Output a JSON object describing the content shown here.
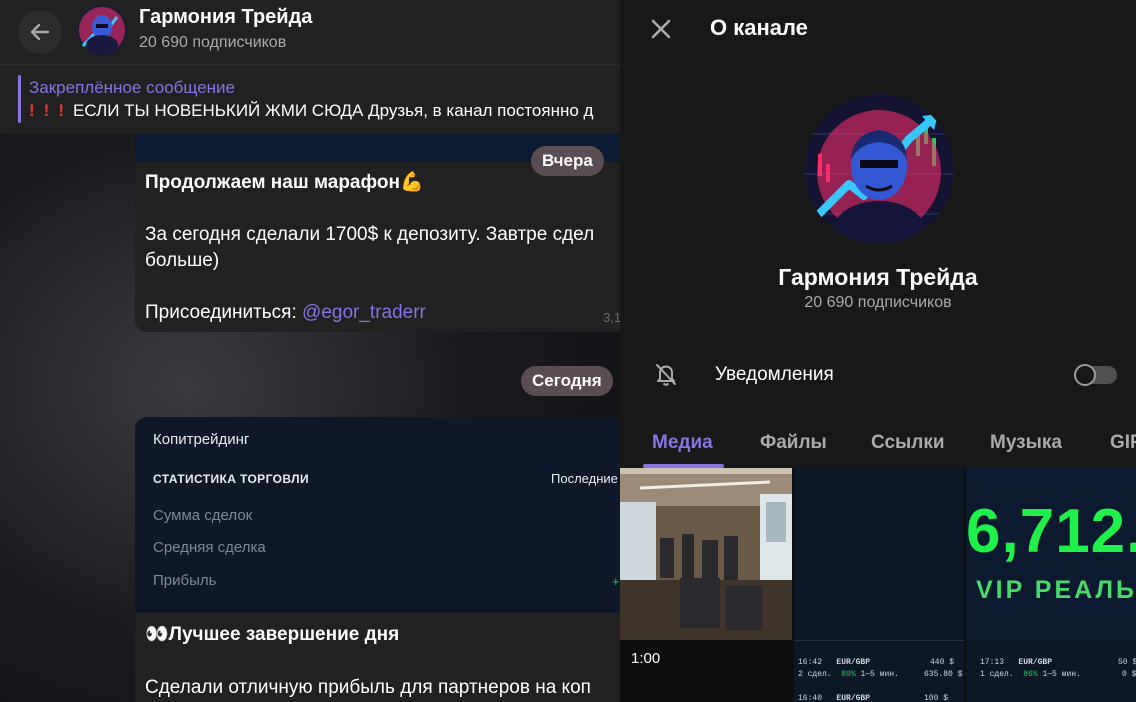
{
  "colors": {
    "accent": "#8774e1",
    "header_bg": "#212121",
    "panel_bg": "#181818",
    "profit_green": "#22c55e",
    "loss_red": "#ff4040"
  },
  "chat_header": {
    "title": "Гармония Трейда",
    "subtitle": "20 690 подписчиков",
    "back_icon": "arrow-left-icon"
  },
  "pinned": {
    "label": "Закреплённое сообщение",
    "marks": [
      "!",
      "!",
      "!"
    ],
    "text": "ЕСЛИ ТЫ НОВЕНЬКИЙ ЖМИ СЮДА Друзья, в канал постоянно д"
  },
  "date_badges": {
    "yesterday": "Вчера",
    "today": "Сегодня"
  },
  "message1": {
    "line1": "Продолжаем наш марафон💪",
    "line2": "За сегодня сделали 1700$ к депозиту. Завтре сдел",
    "line3": "больше)",
    "join_label": "Присоединиться: ",
    "join_link": "@egor_traderr",
    "time": "3,1"
  },
  "message2": {
    "card": {
      "title": "Копитрейдинг",
      "subtitle": "СТАТИСТИКА ТОРГОВЛИ",
      "period": "Последние",
      "rows": [
        "Сумма сделок",
        "Средняя сделка",
        "Прибыль"
      ],
      "plus": "+"
    },
    "line1": "👀Лучшее завершение дня",
    "line2": "Сделали отличную прибыль для партнеров на коп"
  },
  "panel": {
    "title": "О канале",
    "close_icon": "close-icon",
    "channel_name": "Гармония Трейда",
    "subscribers": "20 690 подписчиков",
    "notifications_label": "Уведомления",
    "notifications_on": false,
    "tabs": [
      "Медиа",
      "Файлы",
      "Ссылки",
      "Музыка",
      "GIF"
    ],
    "active_tab": "Медиа"
  },
  "media": {
    "video_time": "1:00",
    "big_number": "6,712.",
    "vip_text": "VIP РЕАЛЬ",
    "trades": [
      {
        "time": "16:42",
        "pair": "EUR/GBP",
        "amount": "440 $",
        "deals": "2 сдел.",
        "pct": "89%",
        "span": "1—5 мин.",
        "result": "635.80 $"
      },
      {
        "time": "17:13",
        "pair": "EUR/GBP",
        "amount": "50 $",
        "deals": "1 сдел.",
        "pct": "86%",
        "span": "1—5 мин.",
        "result": "0 $"
      },
      {
        "time": "16:40",
        "pair": "EUR/GBP",
        "amount": "100 $"
      }
    ]
  }
}
